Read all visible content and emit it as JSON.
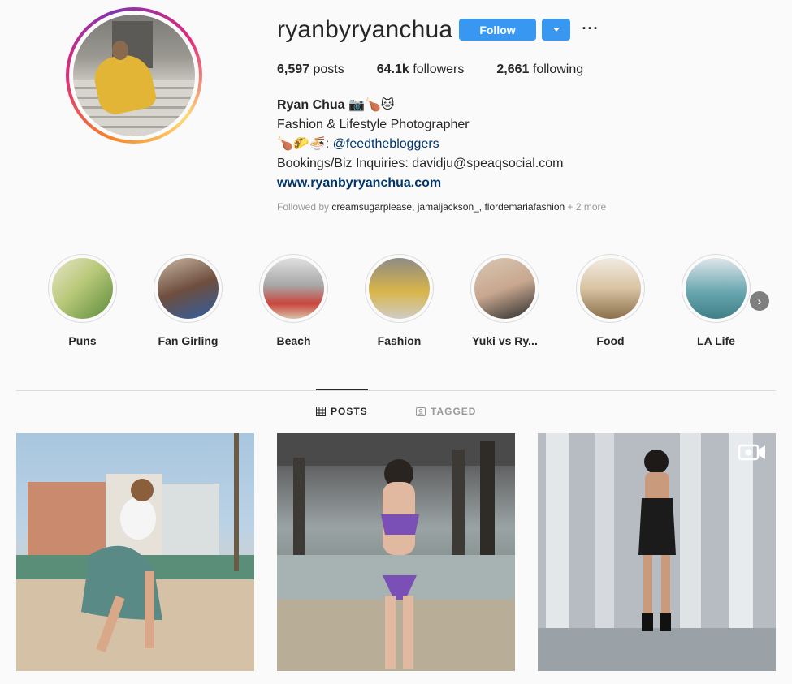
{
  "profile": {
    "username": "ryanbyryanchua",
    "follow_label": "Follow",
    "more_label": "···",
    "stats": {
      "posts_count": "6,597",
      "posts_label": "posts",
      "followers_count": "64.1k",
      "followers_label": "followers",
      "following_count": "2,661",
      "following_label": "following"
    },
    "bio": {
      "name": "Ryan Chua",
      "name_emoji": "📷🍗🐱",
      "line1": "Fashion & Lifestyle Photographer",
      "line2_emoji": "🍗🌮🍜:",
      "line2_mention": "@feedthebloggers",
      "line3": "Bookings/Biz Inquiries: davidju@speaqsocial.com",
      "website": "www.ryanbyryanchua.com"
    },
    "followed_by": {
      "prefix": "Followed by",
      "names": "creamsugarplease, jamaljackson_, flordemariafashion",
      "suffix": "+ 2 more"
    }
  },
  "highlights": [
    {
      "label": "Puns",
      "bg": "#b9c97a"
    },
    {
      "label": "Fan Girling",
      "bg": "#8a6a5a"
    },
    {
      "label": "Beach",
      "bg": "#c9463d"
    },
    {
      "label": "Fashion",
      "bg": "#d8b54a"
    },
    {
      "label": "Yuki vs Ry...",
      "bg": "#c8a78f"
    },
    {
      "label": "Food",
      "bg": "#d9c3a3"
    },
    {
      "label": "LA Life",
      "bg": "#6aa7b0"
    }
  ],
  "tabs": {
    "posts": "POSTS",
    "tagged": "TAGGED"
  },
  "colors": {
    "accent": "#3897f0",
    "link": "#003569",
    "muted": "#999999"
  }
}
